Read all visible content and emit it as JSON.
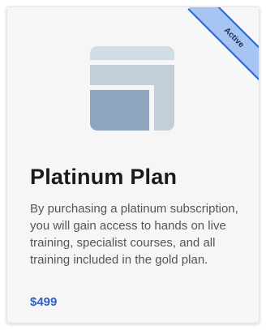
{
  "card": {
    "badge": "Active",
    "icon": "plan-tier-icon",
    "title": "Platinum Plan",
    "description": "By purchasing a platinum subscription, you will gain access to hands on live training, specialist courses, and all training included in the gold plan.",
    "price": "$499"
  },
  "colors": {
    "badge_fill": "#a7c5f2",
    "badge_border": "#2c63d3",
    "price": "#2f5fc4",
    "icon_top": "#cfdde4",
    "icon_mid": "#c4ced6",
    "icon_bottom": "#8da6bd"
  }
}
